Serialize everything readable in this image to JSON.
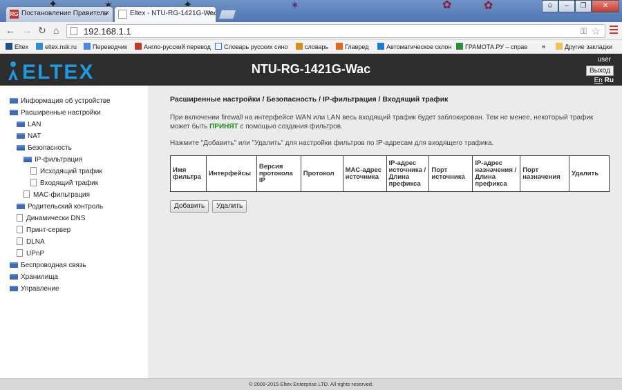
{
  "browser": {
    "tabs": [
      {
        "label": "Постановление Правитель",
        "favicon": "RG"
      },
      {
        "label": "Eltex - NTU-RG-1421G-Wac"
      }
    ],
    "url": "192.168.1.1",
    "bookmarks": [
      "Eltex",
      "eltex.nsk.ru",
      "Переводчик",
      "Англо-русский перевод",
      "Словарь русских сино",
      "словарь",
      "Главред",
      "Автоматическое склон",
      "ГРАМОТА.РУ – справ"
    ],
    "bookmarks_more": "»",
    "other_bookmarks": "Другие закладки"
  },
  "header": {
    "logo_text": "ELTEX",
    "model": "NTU-RG-1421G-Wac",
    "user": "user",
    "logout_label": "Выход",
    "lang_en": "En",
    "lang_ru": "Ru"
  },
  "sidebar": {
    "items": [
      {
        "label": "Информация об устройстве",
        "icon": "folder-icon"
      },
      {
        "label": "Расширенные настройки",
        "icon": "folder-icon"
      },
      {
        "label": "LAN",
        "icon": "folder-icon"
      },
      {
        "label": "NAT",
        "icon": "folder-icon"
      },
      {
        "label": "Безопасность",
        "icon": "folder-open-icon"
      },
      {
        "label": "IP-фильтрация",
        "icon": "folder-open-icon"
      },
      {
        "label": "Исходящий трафик",
        "icon": "page-icon"
      },
      {
        "label": "Входящий трафик",
        "icon": "page-icon"
      },
      {
        "label": "MAC-фильтрация",
        "icon": "page-icon"
      },
      {
        "label": "Родительский контроль",
        "icon": "folder-icon"
      },
      {
        "label": "Динамически DNS",
        "icon": "page-icon"
      },
      {
        "label": "Принт-сервер",
        "icon": "page-icon"
      },
      {
        "label": "DLNA",
        "icon": "page-icon"
      },
      {
        "label": "UPnP",
        "icon": "page-icon"
      },
      {
        "label": "Беспроводная связь",
        "icon": "folder-icon"
      },
      {
        "label": "Хранилища",
        "icon": "folder-icon"
      },
      {
        "label": "Управление",
        "icon": "folder-icon"
      }
    ]
  },
  "main": {
    "breadcrumb": "Расширенные настройки / Безопасность / IP-фильтрация / Входящий трафик",
    "info_before": "При включении firewall на интерфейсе WAN или LAN весь входящий трафик будет заблокирован. Тем не менее, некоторый трафик может быть ",
    "info_accept": "ПРИНЯТ",
    "info_after": " с помощью создания фильтров.",
    "instruction": "Нажмите \"Добавить\" или \"Удалить\" для настройки фильтров по IP-адресам для входящего трафика.",
    "table_headers": [
      "Имя фильтра",
      "Интерфейсы",
      "Версия протокола IP",
      "Протокол",
      "MAC-адрес источника",
      "IP-адрес источника / Длина префикса",
      "Порт источника",
      "IP-адрес назначения / Длина префикса",
      "Порт назначения",
      "Удалить"
    ],
    "add_label": "Добавить",
    "delete_label": "Удалить"
  },
  "footer": {
    "copyright": "© 2009-2015 Eltex Enterprise LTD. All rights reserved."
  },
  "colors": {
    "header_bg": "#2d2d2d",
    "logo_blue": "#1e9be0",
    "accept_green": "#1c8a1c",
    "folder_blue": "#3f6db0",
    "content_bg": "#ebebeb"
  }
}
